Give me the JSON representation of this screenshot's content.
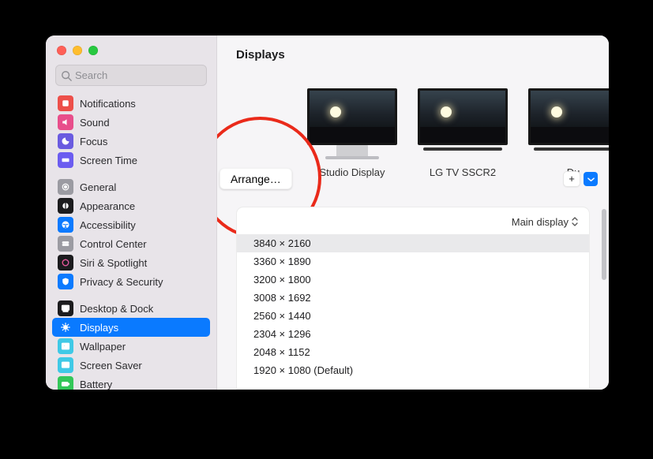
{
  "window": {
    "title": "Displays"
  },
  "search": {
    "placeholder": "Search"
  },
  "traffic": {
    "close": "close",
    "minimize": "minimize",
    "zoom": "zoom"
  },
  "sidebar": {
    "groups": [
      {
        "items": [
          {
            "name": "notifications",
            "label": "Notifications",
            "icon_bg": "#ed4f4a",
            "glyph": "notifications-icon"
          },
          {
            "name": "sound",
            "label": "Sound",
            "icon_bg": "#e84e8b",
            "glyph": "sound-icon"
          },
          {
            "name": "focus",
            "label": "Focus",
            "icon_bg": "#6a5be0",
            "glyph": "focus-icon"
          },
          {
            "name": "screen-time",
            "label": "Screen Time",
            "icon_bg": "#6b5cf0",
            "glyph": "screen-time-icon"
          }
        ]
      },
      {
        "items": [
          {
            "name": "general",
            "label": "General",
            "icon_bg": "#9b9ba2",
            "glyph": "general-icon"
          },
          {
            "name": "appearance",
            "label": "Appearance",
            "icon_bg": "#1c1c1e",
            "glyph": "appearance-icon"
          },
          {
            "name": "accessibility",
            "label": "Accessibility",
            "icon_bg": "#0b7aff",
            "glyph": "accessibility-icon"
          },
          {
            "name": "control-center",
            "label": "Control Center",
            "icon_bg": "#9b9ba2",
            "glyph": "control-center-icon"
          },
          {
            "name": "siri-spotlight",
            "label": "Siri & Spotlight",
            "icon_bg": "#1b1b1e",
            "glyph": "siri-icon"
          },
          {
            "name": "privacy-security",
            "label": "Privacy & Security",
            "icon_bg": "#0b7aff",
            "glyph": "privacy-icon"
          }
        ]
      },
      {
        "items": [
          {
            "name": "desktop-dock",
            "label": "Desktop & Dock",
            "icon_bg": "#1c1c1e",
            "glyph": "dock-icon"
          },
          {
            "name": "displays",
            "label": "Displays",
            "icon_bg": "#0a7aff",
            "glyph": "displays-icon",
            "selected": true
          },
          {
            "name": "wallpaper",
            "label": "Wallpaper",
            "icon_bg": "#3fc9e6",
            "glyph": "wallpaper-icon"
          },
          {
            "name": "screen-saver",
            "label": "Screen Saver",
            "icon_bg": "#3fc9e6",
            "glyph": "screensaver-icon"
          },
          {
            "name": "battery",
            "label": "Battery",
            "icon_bg": "#34c759",
            "glyph": "battery-icon"
          }
        ]
      }
    ]
  },
  "arrange_button": "Arrange…",
  "add_button": "+",
  "displays": [
    {
      "name": "studio",
      "label": "Studio Display",
      "kind": "monitor-with-stand"
    },
    {
      "name": "lg",
      "label": "LG TV SSCR2",
      "kind": "tv"
    },
    {
      "name": "dummy",
      "label": "Du",
      "kind": "tv"
    }
  ],
  "panel": {
    "selector_label": "Main display",
    "resolutions": [
      {
        "label": "3840 × 2160",
        "selected": true
      },
      {
        "label": "3360 × 1890"
      },
      {
        "label": "3200 × 1800"
      },
      {
        "label": "3008 × 1692"
      },
      {
        "label": "2560 × 1440"
      },
      {
        "label": "2304 × 1296"
      },
      {
        "label": "2048 × 1152"
      },
      {
        "label": "1920 × 1080 (Default)"
      }
    ]
  }
}
